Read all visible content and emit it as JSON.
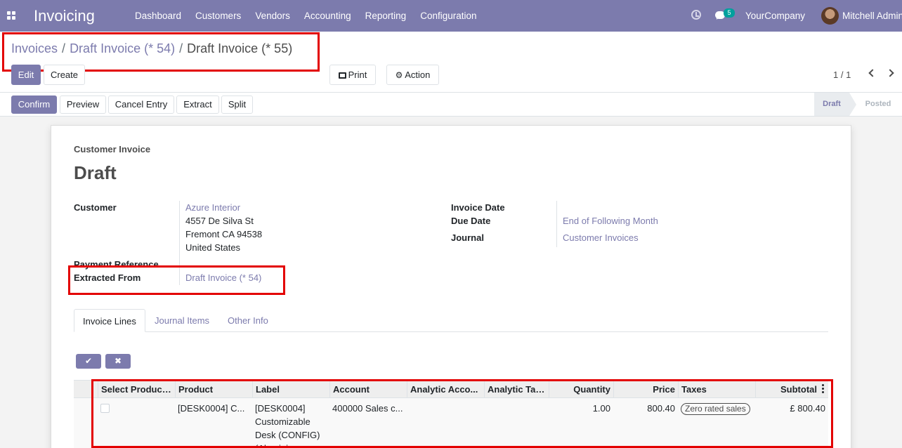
{
  "navbar": {
    "app_title": "Invoicing",
    "menu": [
      "Dashboard",
      "Customers",
      "Vendors",
      "Accounting",
      "Reporting",
      "Configuration"
    ],
    "chat_badge": "5",
    "company": "YourCompany",
    "user": "Mitchell Admin",
    "color": "#7c7bad"
  },
  "breadcrumb": {
    "items": [
      "Invoices",
      "Draft Invoice (* 54)",
      "Draft Invoice (* 55)"
    ],
    "separator": "/"
  },
  "toolbar": {
    "edit": "Edit",
    "create": "Create",
    "print": "Print",
    "action": "Action",
    "pager": "1 / 1"
  },
  "header_buttons": [
    "Confirm",
    "Preview",
    "Cancel Entry",
    "Extract",
    "Split"
  ],
  "status": {
    "stages": [
      "Draft",
      "Posted"
    ],
    "current": "Draft"
  },
  "form": {
    "type_label": "Customer Invoice",
    "title": "Draft",
    "customer_label": "Customer",
    "customer_name": "Azure Interior",
    "address_lines": [
      "4557 De Silva St",
      "Fremont CA 94538",
      "United States"
    ],
    "payment_reference_label": "Payment Reference",
    "extracted_from_label": "Extracted From",
    "extracted_from_value": "Draft Invoice (* 54)",
    "invoice_date_label": "Invoice Date",
    "invoice_date_value": "",
    "due_date_label": "Due Date",
    "due_date_value": "End of Following Month",
    "journal_label": "Journal",
    "journal_value": "Customer Invoices"
  },
  "tabs": [
    "Invoice Lines",
    "Journal Items",
    "Other Info"
  ],
  "table": {
    "headers": [
      "Select Product...",
      "Product",
      "Label",
      "Account",
      "Analytic Acco...",
      "Analytic Tags",
      "Quantity",
      "Price",
      "Taxes",
      "Subtotal"
    ],
    "rows": [
      {
        "product": "[DESK0004] C...",
        "label_lines": [
          "[DESK0004]",
          "Customizable",
          "Desk (CONFIG)",
          "(Aluminium..."
        ],
        "account": "400000 Sales c...",
        "analytic_account": "",
        "analytic_tags": "",
        "quantity": "1.00",
        "price": "800.40",
        "taxes": "Zero rated sales",
        "subtotal": "£ 800.40"
      }
    ]
  }
}
